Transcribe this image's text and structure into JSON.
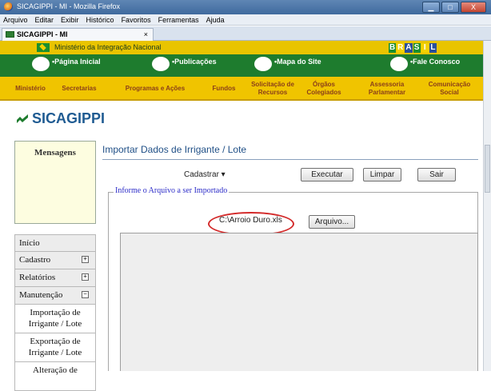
{
  "window": {
    "title": "SICAGIPPI - MI - Mozilla Firefox",
    "minimize": "▁",
    "maximize": "□",
    "close": "X"
  },
  "menubar": [
    "Arquivo",
    "Editar",
    "Exibir",
    "Histórico",
    "Favoritos",
    "Ferramentas",
    "Ajuda"
  ],
  "tab": {
    "label": "SICAGIPPI - MI",
    "close": "×"
  },
  "gov": {
    "ministry": "Ministério da Integração Nacional",
    "brand_letters": [
      "B",
      "R",
      "A",
      "S",
      "I",
      "L"
    ],
    "brand_colors": [
      "#1b8f2e",
      "#f3d200",
      "#2a4f9a",
      "#1b8f2e",
      "#f3d200",
      "#2a4f9a"
    ],
    "nav": [
      "•Página Inicial",
      "•Publicações",
      "•Mapa do Site",
      "•Fale Conosco"
    ],
    "subnav": [
      {
        "line1": "Ministério",
        "line2": ""
      },
      {
        "line1": "Secretarias",
        "line2": ""
      },
      {
        "line1": "Programas e Ações",
        "line2": ""
      },
      {
        "line1": "Fundos",
        "line2": ""
      },
      {
        "line1": "Solicitação de",
        "line2": "Recursos"
      },
      {
        "line1": "Órgãos",
        "line2": "Colegiados"
      },
      {
        "line1": "Assessoria",
        "line2": "Parlamentar"
      },
      {
        "line1": "Comunicação",
        "line2": "Social"
      }
    ],
    "green": "#1e7c2e",
    "yellow": "#f0c400"
  },
  "app": {
    "title": "SICAGIPPI"
  },
  "sidebar": {
    "messages_title": "Mensagens",
    "items": [
      {
        "label": "Início",
        "toggle": ""
      },
      {
        "label": "Cadastro",
        "toggle": "+"
      },
      {
        "label": "Relatórios",
        "toggle": "+"
      },
      {
        "label": "Manutenção",
        "toggle": "−"
      }
    ],
    "subitems": [
      {
        "line1": "Importação de",
        "line2": "Irrigante / Lote"
      },
      {
        "line1": "Exportação de",
        "line2": "Irrigante / Lote"
      },
      {
        "line1": "Alteração de",
        "line2": ""
      }
    ]
  },
  "main": {
    "title": "Importar Dados de Irrigante / Lote",
    "menu": "Cadastrar ▾",
    "buttons": {
      "execute": "Executar",
      "clear": "Limpar",
      "exit": "Sair"
    },
    "legend": "Informe o Arquivo a ser Importado",
    "file_value": "C:\\Arroio Duro.xls",
    "file_button": "Arquivo..."
  }
}
